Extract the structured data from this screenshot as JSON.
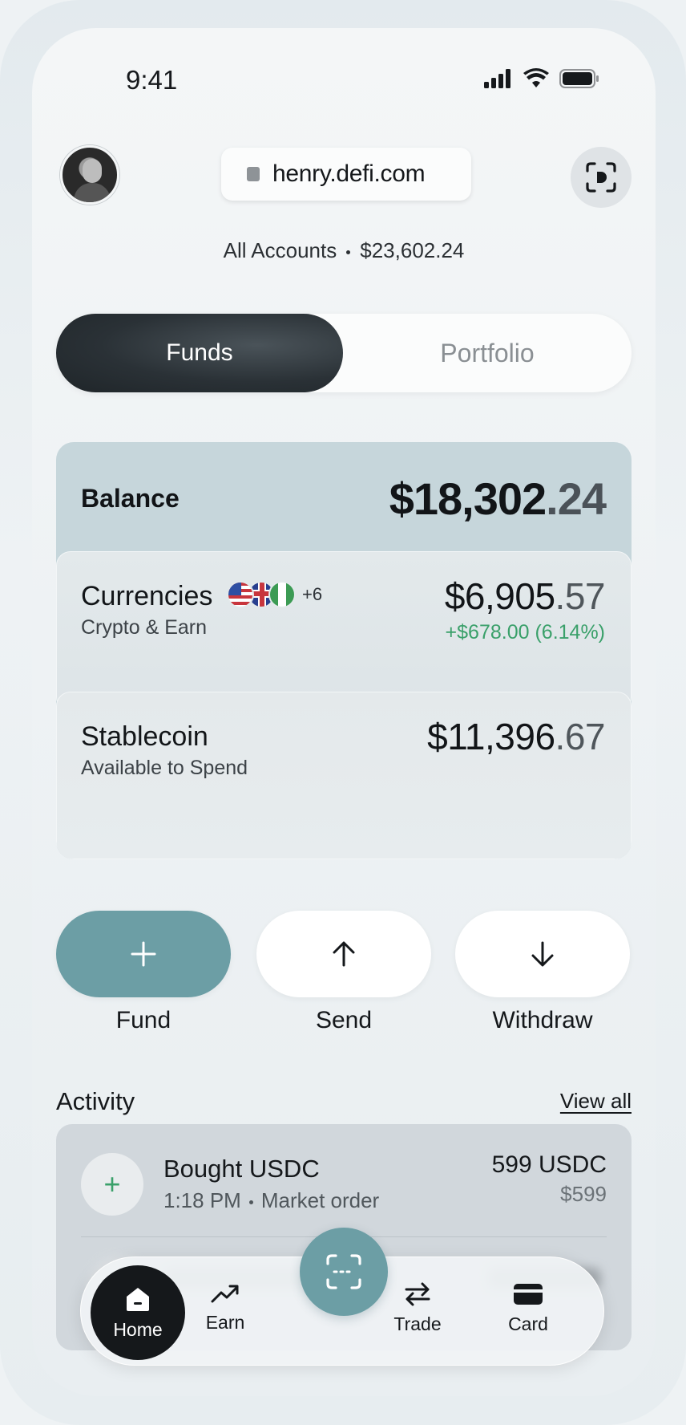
{
  "status_bar": {
    "time": "9:41"
  },
  "header": {
    "url": "henry.defi.com",
    "accounts_label": "All Accounts",
    "accounts_total": "$23,602.24"
  },
  "tabs": [
    {
      "label": "Funds",
      "active": true
    },
    {
      "label": "Portfolio",
      "active": false
    }
  ],
  "balance": {
    "label": "Balance",
    "whole": "$18,302",
    "cents": ".24"
  },
  "currencies": {
    "title": "Currencies",
    "caption": "Crypto & Earn",
    "extra_count": "+6",
    "whole": "$6,905",
    "cents": ".57",
    "change": "+$678.00 (6.14%)",
    "change_color": "#3aa06a",
    "flags": [
      "us-flag-icon",
      "uk-flag-icon",
      "nigeria-flag-icon"
    ]
  },
  "stablecoin": {
    "title": "Stablecoin",
    "caption": "Available to Spend",
    "whole": "$11,396",
    "cents": ".67"
  },
  "actions": [
    {
      "label": "Fund",
      "icon": "plus-icon"
    },
    {
      "label": "Send",
      "icon": "arrow-up-icon"
    },
    {
      "label": "Withdraw",
      "icon": "arrow-down-icon"
    }
  ],
  "activity": {
    "title": "Activity",
    "view_all": "View all",
    "items": [
      {
        "title": "Bought USDC",
        "time": "1:18 PM",
        "type": "Market order",
        "amount": "599 USDC",
        "fiat": "$599",
        "icon": "plus-icon"
      }
    ]
  },
  "nav": [
    {
      "label": "Home",
      "icon": "home-icon",
      "active": true
    },
    {
      "label": "Earn",
      "icon": "trending-up-icon"
    },
    {
      "label": "Trade",
      "icon": "swap-icon"
    },
    {
      "label": "Card",
      "icon": "card-icon"
    }
  ],
  "colors": {
    "accent": "#6c9ea5",
    "dark": "#15181b",
    "positive": "#3aa06a",
    "balance_card": "#c6d6db"
  }
}
